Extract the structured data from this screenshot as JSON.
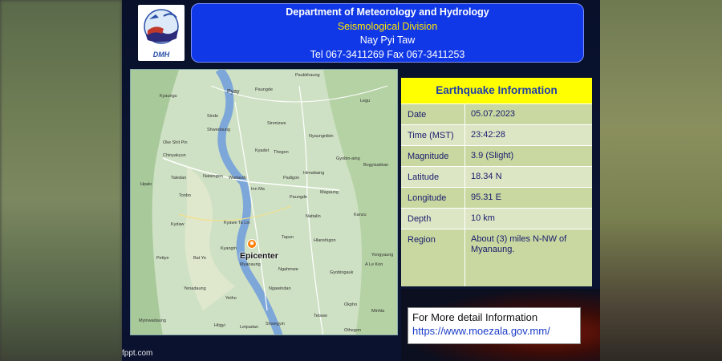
{
  "header": {
    "line1": "Department of Meteorology and Hydrology",
    "line2": "Seismological Division",
    "line3": "Nay Pyi Taw",
    "line4": "Tel 067-3411269 Fax 067-3411253"
  },
  "logo": {
    "text": "DMH",
    "icon": "dmh-logo-icon"
  },
  "map": {
    "epicenter_label": "Epicenter",
    "places": [
      "Paukkhaung",
      "Pyay",
      "Paungde",
      "Sinde",
      "Shwedaung",
      "Kyaungu",
      "Oke Shit Pin",
      "Chinyakyun",
      "Taledan",
      "Hpalo",
      "Tonbo",
      "Kydaw",
      "Natsingon",
      "Wadauth",
      "Inn Ma",
      "Kyadet",
      "Thegon",
      "Padigon",
      "Sinmizwe",
      "Nyaungnibin",
      "Gyobin-aing",
      "Bogyisakkan",
      "Himattaing",
      "Magaung",
      "Paungde",
      "Nattalin",
      "Kanzu",
      "Kyawe Ta Lin",
      "Tapun",
      "Hlanshigon",
      "Pettye",
      "Bat Ye",
      "Kyangin",
      "Myanaung",
      "Ngahmwe",
      "Ngawindan",
      "Gyobingauk",
      "A Le Kon",
      "Okpho",
      "Minhla",
      "Tetswe",
      "Shwegyin",
      "Othegon",
      "Yenadaung",
      "Yetho",
      "Myinwadaung",
      "Htigyi",
      "Letpadan",
      "Legu",
      "Yongyaung"
    ]
  },
  "info": {
    "title": "Earthquake Information",
    "rows": [
      {
        "label": "Date",
        "value": "05.07.2023"
      },
      {
        "label": "Time (MST)",
        "value": "23:42:28"
      },
      {
        "label": "Magnitude",
        "value": "3.9 (Slight)"
      },
      {
        "label": "Latitude",
        "value": "18.34  N"
      },
      {
        "label": "Longitude",
        "value": "95.31  E"
      },
      {
        "label": "Depth",
        "value": "10  km"
      },
      {
        "label": "Region",
        "value": "About  (3)  miles  N-NW of Myanaung."
      }
    ]
  },
  "detail": {
    "line1": "For More detail Information",
    "line2": "https://www.moezala.gov.mm/"
  },
  "footer": {
    "text": "fppt.com"
  },
  "colors": {
    "header_bg": "#1138e6",
    "title_bg": "#ffff00",
    "table_bg": "#c8d8a0",
    "slide_bg": "#0b1533"
  }
}
